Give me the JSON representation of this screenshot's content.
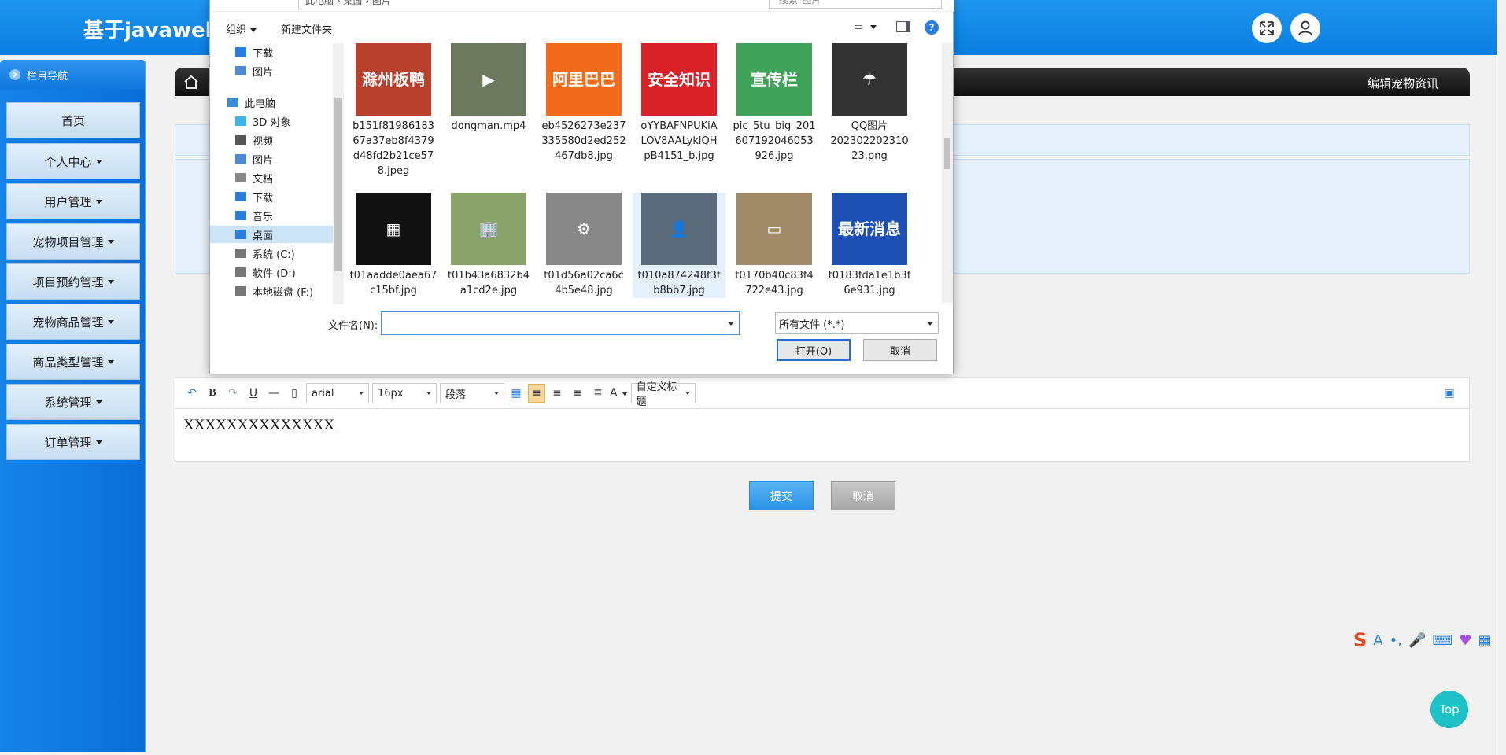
{
  "header": {
    "title": "基于javaweb的"
  },
  "sidebar": {
    "title": "栏目导航",
    "items": [
      {
        "label": "首页",
        "has_caret": false
      },
      {
        "label": "个人中心",
        "has_caret": true
      },
      {
        "label": "用户管理",
        "has_caret": true
      },
      {
        "label": "宠物项目管理",
        "has_caret": true
      },
      {
        "label": "项目预约管理",
        "has_caret": true
      },
      {
        "label": "宠物商品管理",
        "has_caret": true
      },
      {
        "label": "商品类型管理",
        "has_caret": true
      },
      {
        "label": "系统管理",
        "has_caret": true
      },
      {
        "label": "订单管理",
        "has_caret": true
      }
    ]
  },
  "breadcrumb": {
    "title": "编辑宠物资讯"
  },
  "editor": {
    "font_family": "arial",
    "font_size": "16px",
    "paragraph": "段落",
    "custom_title": "自定义标题",
    "content": "XXXXXXXXXXXXXX"
  },
  "buttons": {
    "submit": "提交",
    "cancel": "取消",
    "top": "Top"
  },
  "file_dialog": {
    "address": "此电脑 › 桌面 › 图片",
    "search_placeholder": "搜索\"图片\"",
    "organize": "组织",
    "new_folder": "新建文件夹",
    "help": "?",
    "nav_tree": [
      {
        "label": "下载",
        "icon": "download-arrow-icon"
      },
      {
        "label": "图片",
        "icon": "pictures-icon"
      },
      {
        "label": "此电脑",
        "icon": "computer-icon"
      },
      {
        "label": "3D 对象",
        "icon": "3d-objects-icon"
      },
      {
        "label": "视频",
        "icon": "video-icon"
      },
      {
        "label": "图片",
        "icon": "pictures-icon"
      },
      {
        "label": "文档",
        "icon": "document-icon"
      },
      {
        "label": "下载",
        "icon": "download-arrow-icon"
      },
      {
        "label": "音乐",
        "icon": "music-icon"
      },
      {
        "label": "桌面",
        "icon": "desktop-icon",
        "selected": true
      },
      {
        "label": "系统 (C:)",
        "icon": "drive-icon"
      },
      {
        "label": "软件 (D:)",
        "icon": "drive-icon"
      },
      {
        "label": "本地磁盘 (F:)",
        "icon": "drive-icon"
      }
    ],
    "files": [
      {
        "name": "b151f81986183\n67a37eb8f4379\nd48fd2b21ce57\n8.jpeg",
        "thumb_text": "滁州板鸭",
        "thumb_color": "#b8412e"
      },
      {
        "name": "dongman.mp4",
        "thumb_text": "▶",
        "thumb_color": "#6b7a5e"
      },
      {
        "name": "eb4526273e237\n335580d2ed252\n467db8.jpg",
        "thumb_text": "阿里巴巴",
        "thumb_color": "#f26b1d"
      },
      {
        "name": "oYYBAFNPUKiA\nLOV8AALyklQH\npB4151_b.jpg",
        "thumb_text": "安全知识",
        "thumb_color": "#d82228"
      },
      {
        "name": "pic_5tu_big_201\n607192046053\n926.jpg",
        "thumb_text": "宣传栏",
        "thumb_color": "#3fa35a"
      },
      {
        "name": "QQ图片\n202302202310\n23.png",
        "thumb_text": "☂",
        "thumb_color": "#333333"
      },
      {
        "name": "t01aadde0aea67\nc15bf.jpg",
        "thumb_text": "▦",
        "thumb_color": "#111111"
      },
      {
        "name": "t01b43a6832b4\na1cd2e.jpg",
        "thumb_text": "🏢",
        "thumb_color": "#8aa36b"
      },
      {
        "name": "t01d56a02ca6c\n4b5e48.jpg",
        "thumb_text": "⚙",
        "thumb_color": "#888888"
      },
      {
        "name": "t010a874248f3f\nb8bb7.jpg",
        "thumb_text": "👤",
        "thumb_color": "#5a6a7a"
      },
      {
        "name": "t0170b40c83f4\n722e43.jpg",
        "thumb_text": "▭",
        "thumb_color": "#a08a68"
      },
      {
        "name": "t0183fda1e1b3f\n6e931.jpg",
        "thumb_text": "最新消息",
        "thumb_color": "#1d4fb5"
      }
    ],
    "filename_label": "文件名(N):",
    "filename_value": "",
    "filetype": "所有文件 (*.*)",
    "open": "打开(O)",
    "cancel": "取消"
  }
}
